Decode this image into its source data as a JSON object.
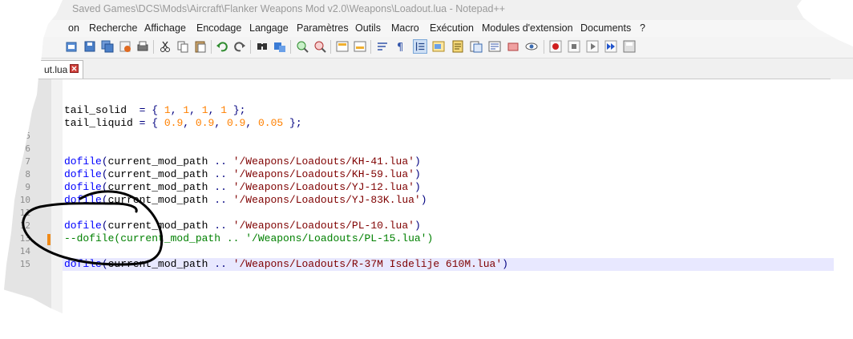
{
  "window": {
    "title": "Saved Games\\DCS\\Mods\\Aircraft\\Flanker Weapons Mod v2.0\\Weapons\\Loadout.lua - Notepad++"
  },
  "menu": [
    "on",
    "Recherche",
    "Affichage",
    "Encodage",
    "Langage",
    "Paramètres",
    "Outils",
    "Macro",
    "Exécution",
    "Modules d'extension",
    "Documents",
    "?"
  ],
  "toolbar": {
    "icons": [
      "open-file-icon",
      "save-icon",
      "save-all-icon",
      "close-icon",
      "print-icon",
      "cut-icon",
      "copy-icon",
      "paste-icon",
      "undo-icon",
      "redo-icon",
      "find-icon",
      "replace-icon",
      "zoom-in-icon",
      "zoom-out-icon",
      "sync-vertical-icon",
      "sync-horizontal-icon",
      "word-wrap-icon",
      "show-all-chars-icon",
      "indent-guide-icon",
      "user-language-icon",
      "doc-map-icon",
      "function-list-icon",
      "folder-workspace-icon",
      "monitor-icon",
      "record-macro-icon",
      "stop-macro-icon",
      "play-macro-icon",
      "run-macro-multiple-icon",
      "save-macro-icon"
    ]
  },
  "tab": {
    "label": "ut.lua"
  },
  "editor": {
    "lines": [
      {
        "num": "",
        "text": "tail_solid  = { 1, 1, 1, 1 };"
      },
      {
        "num": "",
        "text": "tail_liquid = { 0.9, 0.9, 0.9, 0.05 };"
      },
      {
        "num": "5",
        "text": ""
      },
      {
        "num": "6",
        "text": ""
      },
      {
        "num": "7",
        "text": "dofile(current_mod_path .. '/Weapons/Loadouts/KH-41.lua')"
      },
      {
        "num": "8",
        "text": "dofile(current_mod_path .. '/Weapons/Loadouts/KH-59.lua')"
      },
      {
        "num": "9",
        "text": "dofile(current_mod_path .. '/Weapons/Loadouts/YJ-12.lua')"
      },
      {
        "num": "10",
        "text": "dofile(current_mod_path .. '/Weapons/Loadouts/YJ-83K.lua')"
      },
      {
        "num": "11",
        "text": ""
      },
      {
        "num": "12",
        "text": "dofile(current_mod_path .. '/Weapons/Loadouts/PL-10.lua')"
      },
      {
        "num": "13",
        "text": "--dofile(current_mod_path .. '/Weapons/Loadouts/PL-15.lua')"
      },
      {
        "num": "14",
        "text": ""
      },
      {
        "num": "15",
        "text": "dofile(current_mod_path .. '/Weapons/Loadouts/R-37M Isdelije 610M.lua')"
      }
    ]
  },
  "colors": {
    "keyword": "#0000ff",
    "number": "#ff8000",
    "string": "#7f0000",
    "comment": "#008000",
    "change_marker": "#f08a18",
    "current_line": "#e8e8ff",
    "annotation_circle": "#000000"
  }
}
